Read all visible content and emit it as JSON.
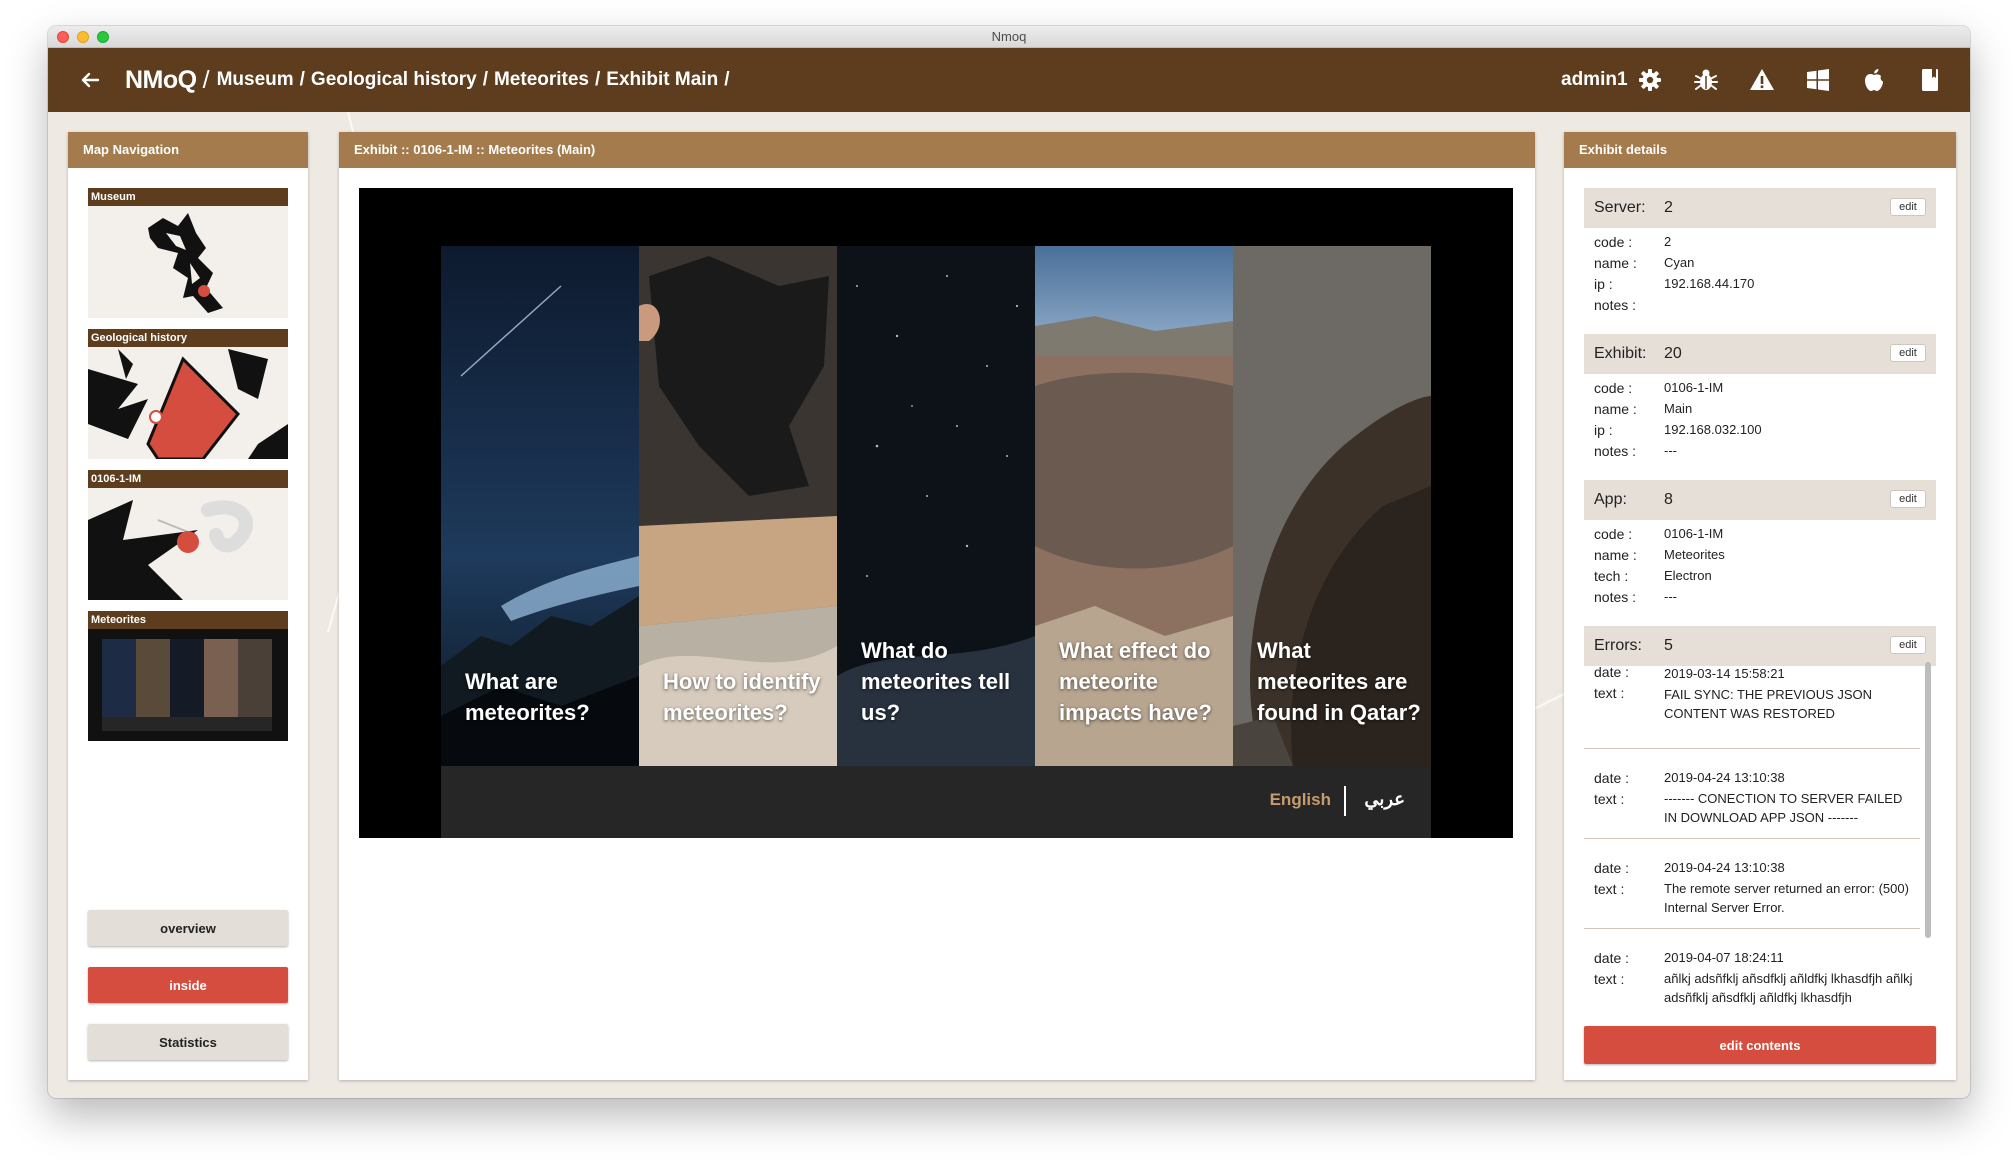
{
  "window": {
    "title": "Nmoq"
  },
  "header": {
    "brand": "NMoQ",
    "crumbs": [
      "Museum",
      "Geological history",
      "Meteorites",
      "Exhibit Main"
    ],
    "sep": "/",
    "user": "admin1",
    "icons": [
      "gear-icon",
      "bug-icon",
      "warning-icon",
      "windows-icon",
      "apple-icon",
      "book-icon"
    ]
  },
  "left_panel": {
    "title": "Map Navigation",
    "thumbs": [
      "Museum",
      "Geological history",
      "0106-1-IM",
      "Meteorites"
    ],
    "buttons": {
      "overview": "overview",
      "inside": "inside",
      "statistics": "Statistics"
    }
  },
  "middle_panel": {
    "title": "Exhibit :: 0106-1-IM :: Meteorites (Main)",
    "slides": [
      "What are meteorites?",
      "How to identify meteorites?",
      "What do meteorites tell us?",
      "What effect do meteorite impacts have?",
      "What meteorites are found in Qatar?"
    ],
    "lang_en": "English",
    "lang_ar": "عربي"
  },
  "right_panel": {
    "title": "Exhibit details",
    "edit_label": "edit",
    "server": {
      "label": "Server:",
      "value": "2",
      "rows": [
        {
          "k": "code :",
          "v": "2"
        },
        {
          "k": "name :",
          "v": "Cyan"
        },
        {
          "k": "ip :",
          "v": "192.168.44.170"
        },
        {
          "k": "notes :",
          "v": ""
        }
      ]
    },
    "exhibit": {
      "label": "Exhibit:",
      "value": "20",
      "rows": [
        {
          "k": "code :",
          "v": "0106-1-IM"
        },
        {
          "k": "name :",
          "v": "Main"
        },
        {
          "k": "ip :",
          "v": "192.168.032.100"
        },
        {
          "k": "notes :",
          "v": "---"
        }
      ]
    },
    "app": {
      "label": "App:",
      "value": "8",
      "rows": [
        {
          "k": "code :",
          "v": "0106-1-IM"
        },
        {
          "k": "name :",
          "v": "Meteorites"
        },
        {
          "k": "tech :",
          "v": "Electron"
        },
        {
          "k": "notes :",
          "v": "---"
        }
      ]
    },
    "errors": {
      "label": "Errors:",
      "value": "5",
      "date_label": "date :",
      "text_label": "text :",
      "items": [
        {
          "date": "2019-03-14 15:58:21",
          "text": "FAIL SYNC: THE PREVIOUS JSON CONTENT WAS RESTORED"
        },
        {
          "date": "2019-04-24 13:10:38",
          "text": "------- CONECTION TO SERVER FAILED IN DOWNLOAD APP JSON -------"
        },
        {
          "date": "2019-04-24 13:10:38",
          "text": "The remote server returned an error: (500) Internal Server Error."
        },
        {
          "date": "2019-04-07 18:24:11",
          "text": "añlkj adsñfklj añsdfklj añldfkj lkhasdfjh añlkj adsñfklj añsdfklj añldfkj lkhasdfjh"
        }
      ]
    },
    "edit_contents": "edit contents"
  }
}
